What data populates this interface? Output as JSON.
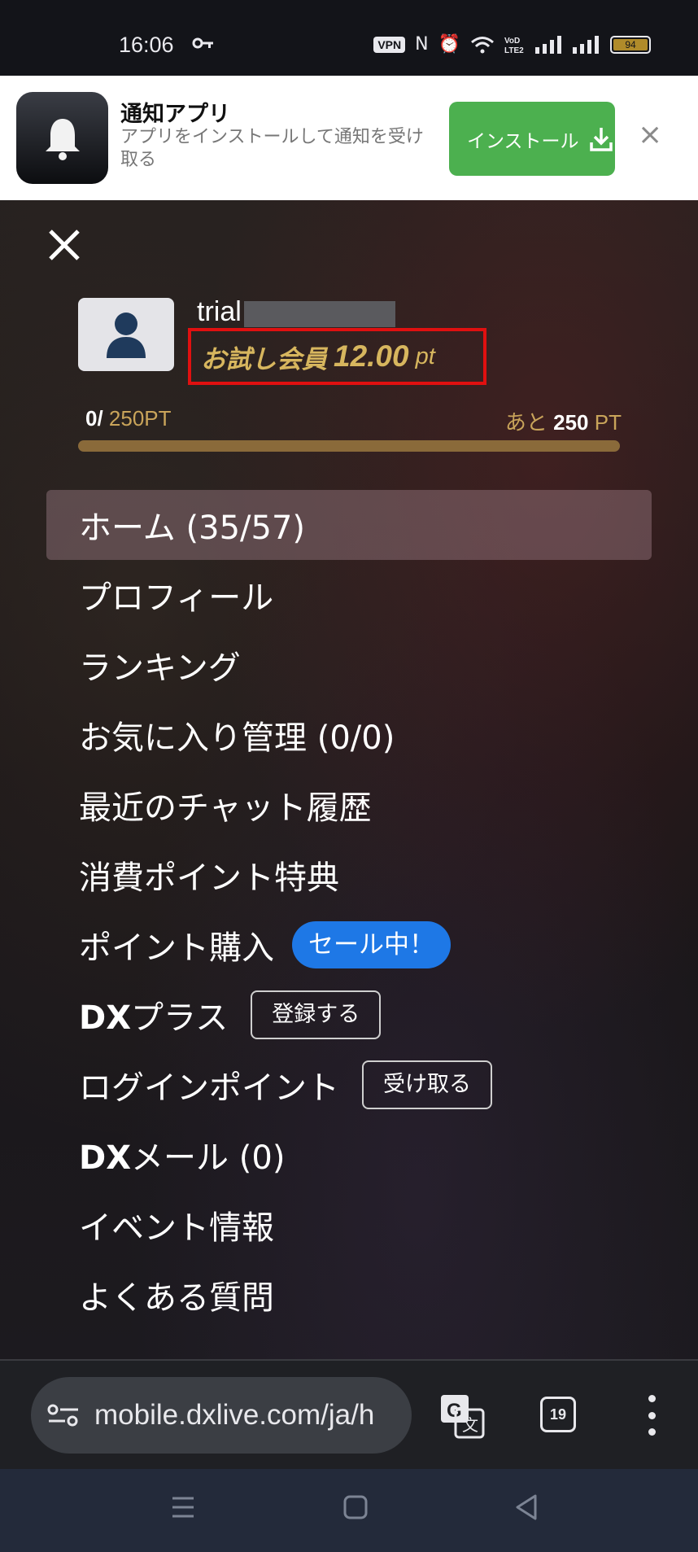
{
  "status_bar": {
    "time": "16:06",
    "vpn": "VPN",
    "battery": "94"
  },
  "banner": {
    "title": "通知アプリ",
    "description": "アプリをインストールして通知を受け取る",
    "install_label": "インストール",
    "close_symbol": "×",
    "accent_color": "#4cb04f"
  },
  "drawer": {
    "username": "trial",
    "points_label": "お試し会員",
    "points_value": "12.00",
    "points_unit": "pt",
    "progress": {
      "current": "0/",
      "target": "250PT",
      "remaining_prefix": "あと",
      "remaining_value": "250",
      "remaining_unit": "PT",
      "fraction": 0
    },
    "menu": {
      "home": "ホーム (35/57)",
      "profile": "プロフィール",
      "ranking": "ランキング",
      "favorites": "お気に入り管理 (0/0)",
      "recent_chat": "最近のチャット履歴",
      "points_benefit": "消費ポイント特典",
      "purchase": "ポイント購入",
      "sale_badge": "セール中！",
      "dx_plus_prefix": "DX",
      "dx_plus_suffix": "プラス",
      "dx_plus_button": "登録する",
      "login_point": "ログインポイント",
      "login_point_button": "受け取る",
      "dx_mail_prefix": "DX",
      "dx_mail_suffix": "メール (0)",
      "events": "イベント情報",
      "faq": "よくある質問"
    }
  },
  "browser": {
    "url": "mobile.dxlive.com/ja/h",
    "tab_count": "19"
  },
  "colors": {
    "gold": "#c9a45a",
    "sale_blue": "#1e78e6",
    "highlight_red": "#e01010"
  }
}
